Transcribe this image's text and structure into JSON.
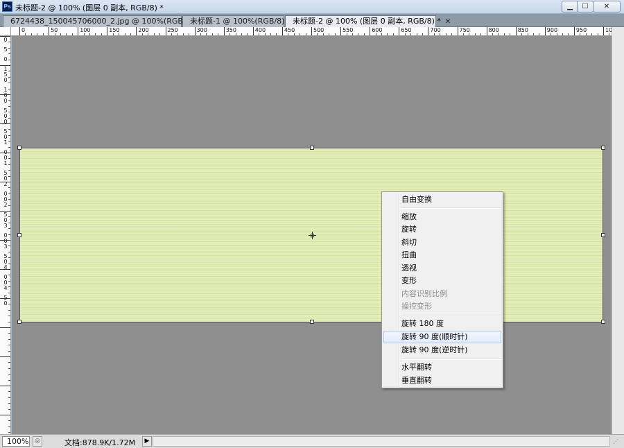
{
  "window": {
    "app_icon": "Ps",
    "title": "未标题-2 @ 100% (图层 0 副本, RGB/8) *",
    "minimize": "▁",
    "maximize": "☐",
    "close": "✕"
  },
  "tabs": [
    {
      "label": "6724438_150045706000_2.jpg @ 100%(RGB/8#) *",
      "close": "✕",
      "active": false
    },
    {
      "label": "未标题-1 @ 100%(RGB/8) *",
      "close": "✕",
      "active": false
    },
    {
      "label": "未标题-2 @ 100% (图层 0 副本, RGB/8) *",
      "close": "✕",
      "active": true
    }
  ],
  "ruler_top": [
    "0",
    "50",
    "100",
    "150",
    "200",
    "250",
    "300",
    "350",
    "400",
    "450",
    "500",
    "550",
    "600",
    "650",
    "700",
    "750",
    "800",
    "850",
    "900",
    "950",
    "10"
  ],
  "ruler_left": [
    "0",
    "5",
    "0",
    "1",
    "5",
    "0",
    "1",
    "0",
    "0",
    "5",
    "0",
    "0",
    "5",
    "0",
    "1",
    "0",
    "0",
    "1",
    "5",
    "0",
    "2",
    "0",
    "0",
    "2",
    "5",
    "0",
    "3",
    "0",
    "0",
    "3",
    "5",
    "0",
    "4",
    "0",
    "0",
    "4",
    "5",
    "0"
  ],
  "context_menu": {
    "items": [
      {
        "label": "自由变换",
        "enabled": true
      },
      {
        "label": "缩放",
        "enabled": true
      },
      {
        "label": "旋转",
        "enabled": true
      },
      {
        "label": "斜切",
        "enabled": true
      },
      {
        "label": "扭曲",
        "enabled": true
      },
      {
        "label": "透视",
        "enabled": true
      },
      {
        "label": "变形",
        "enabled": true
      },
      {
        "label": "内容识别比例",
        "enabled": false
      },
      {
        "label": "操控变形",
        "enabled": false
      },
      {
        "label": "旋转 180 度",
        "enabled": true
      },
      {
        "label": "旋转 90 度(顺时针)",
        "enabled": true,
        "highlighted": true
      },
      {
        "label": "旋转 90 度(逆时针)",
        "enabled": true
      },
      {
        "label": "水平翻转",
        "enabled": true
      },
      {
        "label": "垂直翻转",
        "enabled": true
      }
    ]
  },
  "status": {
    "zoom": "100%",
    "doc_info": "文档:878.9K/1.72M",
    "arrow": "▶",
    "grip": "⋰"
  },
  "colors": {
    "canvas_bg": "#8f8f8f",
    "image_fill": "#dfeaae",
    "menu_bg": "#f0f0f0",
    "menu_highlight": "#e2ecfa"
  }
}
